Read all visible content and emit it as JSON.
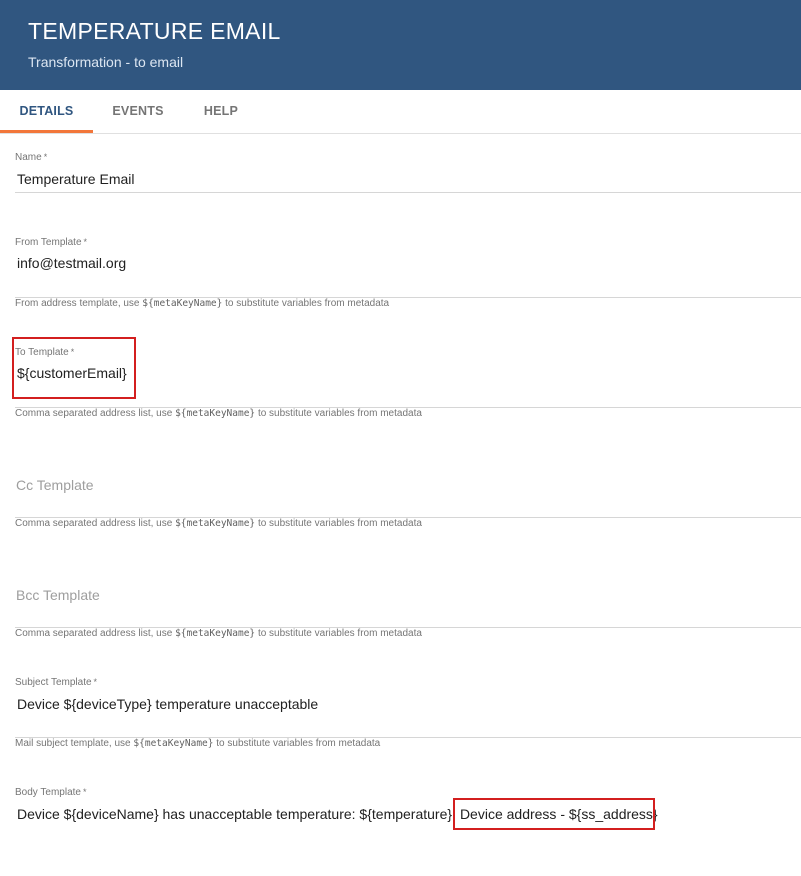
{
  "header": {
    "title": "TEMPERATURE EMAIL",
    "subtitle": "Transformation - to email"
  },
  "tabs": [
    {
      "label": "DETAILS",
      "active": true
    },
    {
      "label": "EVENTS",
      "active": false
    },
    {
      "label": "HELP",
      "active": false
    }
  ],
  "form": {
    "name": {
      "label": "Name",
      "required_mark": "*",
      "value": "Temperature Email"
    },
    "from_template": {
      "label": "From Template",
      "required_mark": "*",
      "value": "info@testmail.org",
      "hint_prefix": "From address template, use",
      "hint_code": "${metaKeyName}",
      "hint_suffix": "to substitute variables from metadata"
    },
    "to_template": {
      "label": "To Template",
      "required_mark": "*",
      "value": "${customerEmail}",
      "hint_prefix": "Comma separated address list, use",
      "hint_code": "${metaKeyName}",
      "hint_suffix": "to substitute variables from metadata"
    },
    "cc_template": {
      "placeholder": "Cc Template",
      "hint_prefix": "Comma separated address list, use",
      "hint_code": "${metaKeyName}",
      "hint_suffix": "to substitute variables from metadata"
    },
    "bcc_template": {
      "placeholder": "Bcc Template",
      "hint_prefix": "Comma separated address list, use",
      "hint_code": "${metaKeyName}",
      "hint_suffix": "to substitute variables from metadata"
    },
    "subject_template": {
      "label": "Subject Template",
      "required_mark": "*",
      "value": "Device ${deviceType} temperature unacceptable",
      "hint_prefix": "Mail subject template, use",
      "hint_code": "${metaKeyName}",
      "hint_suffix": "to substitute variables from metadata"
    },
    "body_template": {
      "label": "Body Template",
      "required_mark": "*",
      "value_part1": "Device ${deviceName} has unacceptable temperature: ${temperature}.",
      "value_part2": "Device address - ${ss_address}"
    }
  },
  "colors": {
    "header_bg": "#305680",
    "tab_ink": "#f2763a",
    "highlight": "#d31f1f"
  }
}
